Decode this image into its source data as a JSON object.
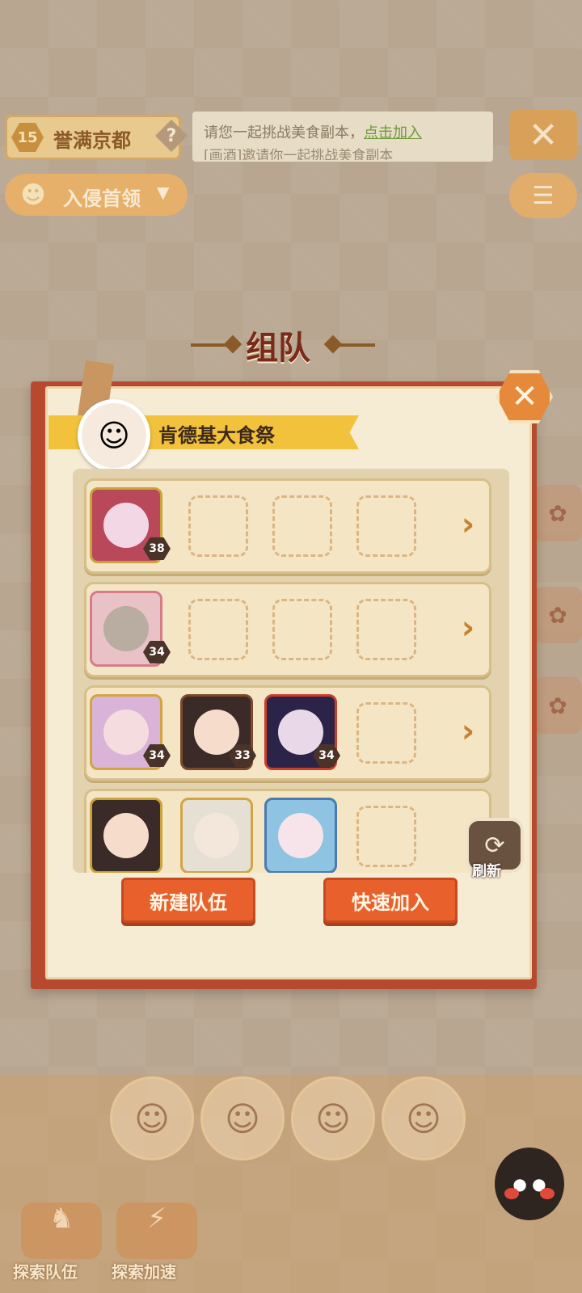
{
  "top_bar": {
    "level": "15",
    "location_name": "誉满京都",
    "help_icon": "question-icon",
    "chat_line1": "请您一起挑战美食副本，",
    "chat_link": "点击加入",
    "chat_line2": "[画酒]邀请你一起挑战美食副本",
    "close_icon": "close-icon"
  },
  "dropdown": {
    "label": "入侵首领",
    "chevron": "▼"
  },
  "list_icon": "list-icon",
  "dialog": {
    "title": "组队",
    "event_name": "肯德基大食祭",
    "close_icon": "close-icon",
    "teams": [
      {
        "members": [
          {
            "level": "38",
            "frame": "samurai-gold"
          }
        ],
        "empty_slots": 3
      },
      {
        "members": [
          {
            "level": "34",
            "frame": "sakura-pink"
          }
        ],
        "empty_slots": 3
      },
      {
        "members": [
          {
            "level": "34",
            "frame": "gold-ornate"
          },
          {
            "level": "33",
            "frame": "brown"
          },
          {
            "level": "34",
            "frame": "torii-red"
          }
        ],
        "empty_slots": 1
      },
      {
        "members": [
          {
            "level": "",
            "frame": "gold-sun"
          },
          {
            "level": "",
            "frame": "maple"
          },
          {
            "level": "",
            "frame": "wave-blue"
          }
        ],
        "empty_slots": 1
      }
    ],
    "refresh_label": "刷新",
    "buttons": {
      "new_team": "新建队伍",
      "quick_join": "快速加入"
    }
  },
  "bottom": {
    "explore_team": "探索队伍",
    "explore_speed": "探索加速"
  },
  "colors": {
    "panel_red": "#b74a2e",
    "paper": "#f6ecd4",
    "banner_yellow": "#f2c23c",
    "button_orange": "#e8612c",
    "arrow_orange": "#c4822c"
  }
}
